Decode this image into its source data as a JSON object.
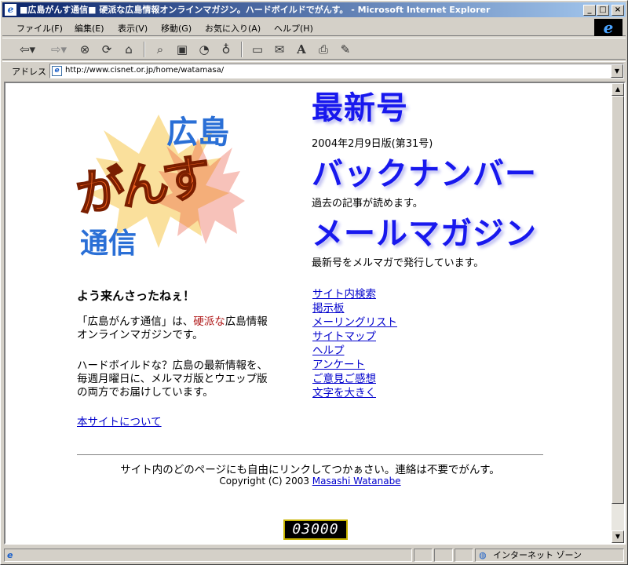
{
  "window": {
    "title": "■広島がんす通信■ 硬派な広島情報オンラインマガジン。ハードボイルドでがんす。 - Microsoft Internet Explorer"
  },
  "menu": {
    "items": [
      "ファイル(F)",
      "編集(E)",
      "表示(V)",
      "移動(G)",
      "お気に入り(A)",
      "ヘルプ(H)"
    ]
  },
  "toolbar": {
    "buttons": [
      "back-icon",
      "forward-icon",
      "stop-icon",
      "refresh-icon",
      "home-icon",
      "search-icon",
      "favorites-icon",
      "history-icon",
      "channels-icon",
      "fullscreen-icon",
      "mail-icon",
      "font-icon",
      "print-icon",
      "edit-icon"
    ]
  },
  "address": {
    "label": "アドレス",
    "url": "http://www.cisnet.or.jp/home/watamasa/"
  },
  "logo": {
    "pref": "広島",
    "main": "がんす",
    "sub": "通信"
  },
  "sections": {
    "latest": {
      "title": "最新号",
      "desc": "2004年2月9日版(第31号)"
    },
    "backnumber": {
      "title": "バックナンバー",
      "desc": "過去の記事が読めます。"
    },
    "mailmag": {
      "title": "メールマガジン",
      "desc": "最新号をメルマガで発行しています。"
    }
  },
  "intro": {
    "welcome": "よう来んさったねぇ！",
    "p1_pre": "「広島がんす通信」は、",
    "p1_red": "硬派な",
    "p1_post": "広島情報",
    "p1_line2": "オンラインマガジンです。",
    "p2_line1": "ハードボイルドな？広島の最新情報を、",
    "p2_line2": "毎週月曜日に、メルマガ版とウエップ版",
    "p2_line3": "の両方でお届けしています。",
    "about_link": "本サイトについて"
  },
  "nav_links": [
    "サイト内検索",
    "掲示板",
    "メーリングリスト",
    "サイトマップ",
    "ヘルプ",
    "アンケート",
    "ご意見ご感想",
    "文字を大きく"
  ],
  "footer": {
    "notice": "サイト内のどのページにも自由にリンクしてつかぁさい。連絡は不要でがんす。",
    "copyright_pre": "Copyright (C) 2003 ",
    "author": "Masashi Watanabe"
  },
  "counter": "03000",
  "status": {
    "zone": "インターネット ゾーン"
  },
  "colors": {
    "heading_blue": "#1818ee",
    "link_blue": "#0000cc",
    "logo_orange": "#f26522",
    "logo_blue": "#2a6fd6",
    "accent_red": "#b01818"
  }
}
